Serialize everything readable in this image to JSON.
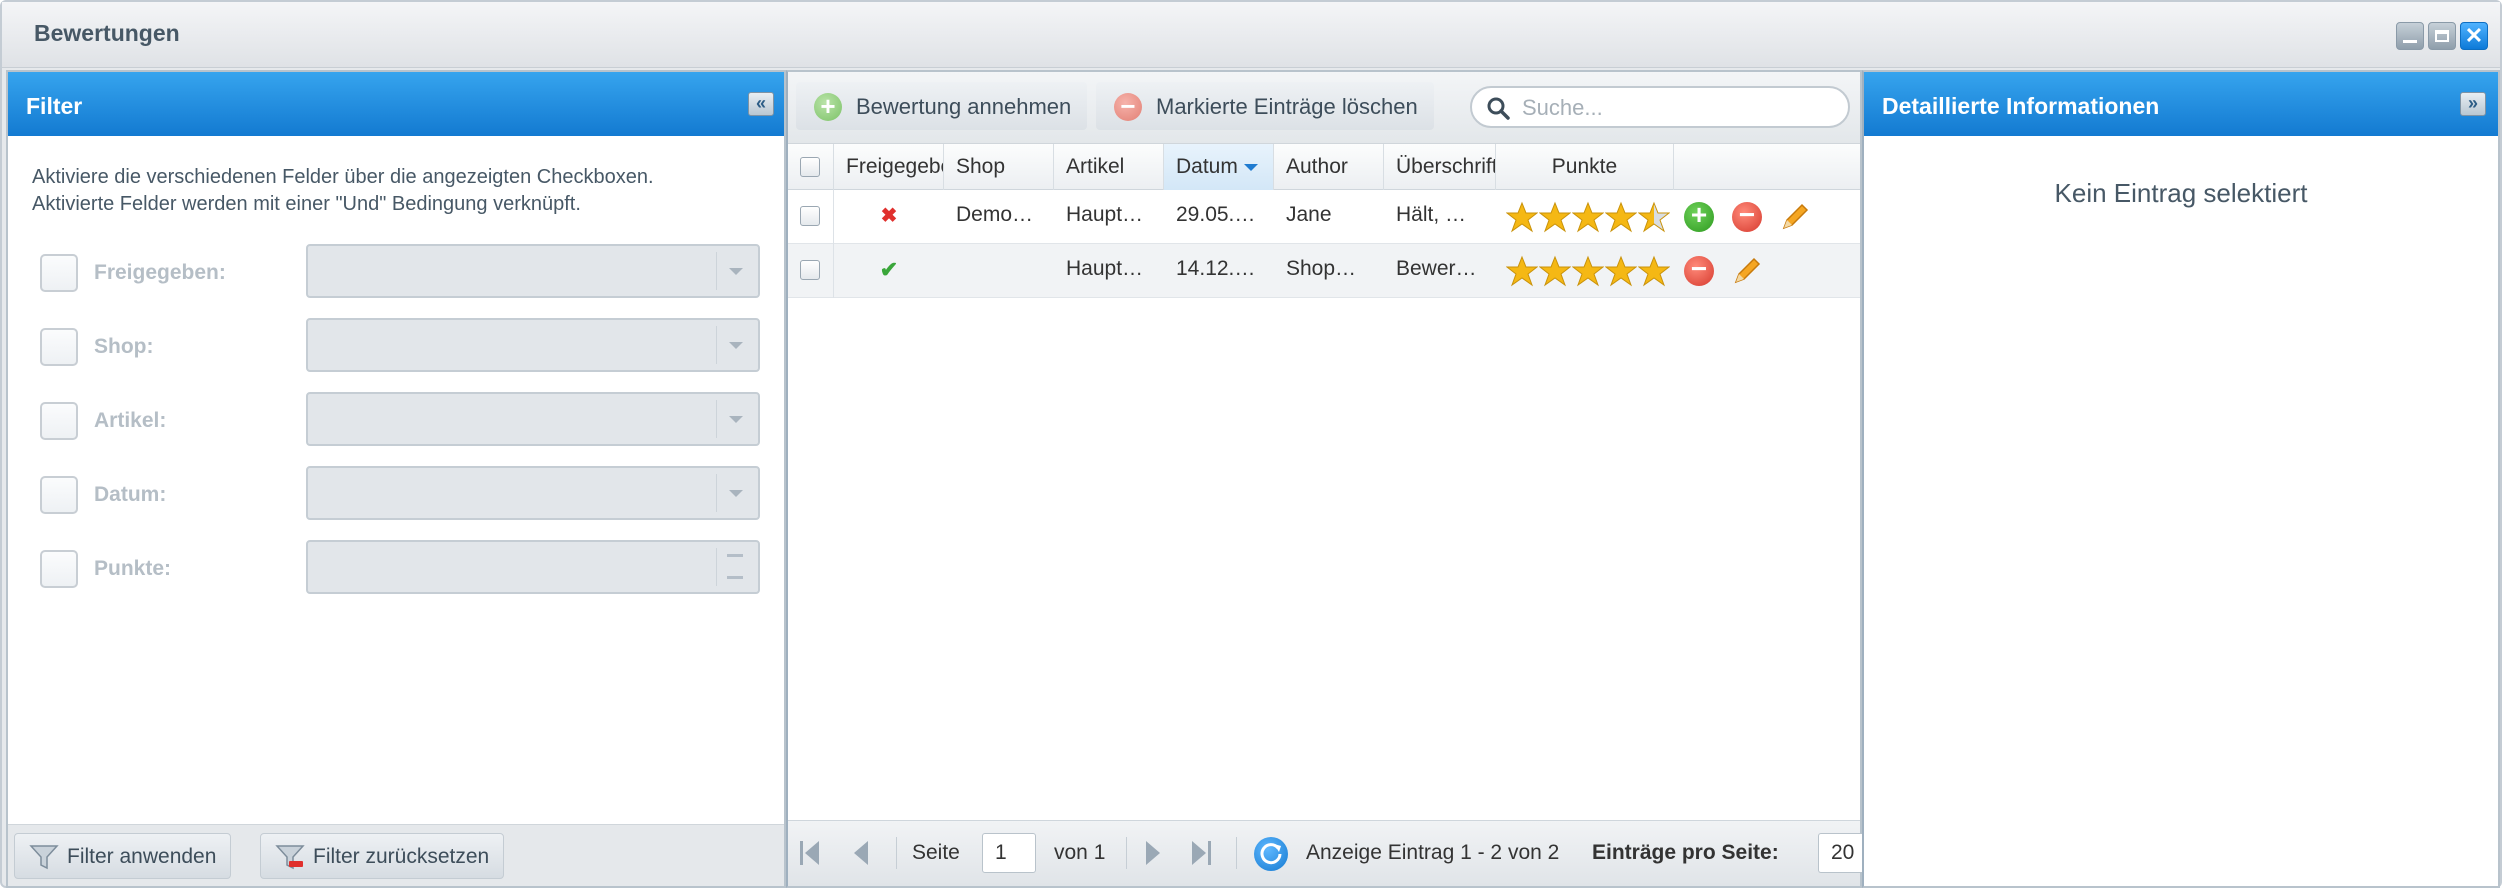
{
  "window": {
    "title": "Bewertungen"
  },
  "filter": {
    "header": "Filter",
    "collapse_glyph": "«",
    "info_line1": "Aktiviere die verschiedenen Felder über die angezeigten Checkboxen.",
    "info_line2": "Aktivierte Felder werden mit einer \"Und\" Bedingung verknüpft.",
    "fields": [
      {
        "label": "Freigegeben:",
        "type": "combo"
      },
      {
        "label": "Shop:",
        "type": "combo"
      },
      {
        "label": "Artikel:",
        "type": "combo"
      },
      {
        "label": "Datum:",
        "type": "combo"
      },
      {
        "label": "Punkte:",
        "type": "number"
      }
    ],
    "apply_label": "Filter anwenden",
    "reset_label": "Filter zurücksetzen"
  },
  "toolbar": {
    "accept_label": "Bewertung annehmen",
    "delete_label": "Markierte Einträge löschen",
    "search_placeholder": "Suche..."
  },
  "grid": {
    "columns": [
      "Freigegeben",
      "Shop",
      "Artikel",
      "Datum",
      "Author",
      "Überschrift",
      "Punkte"
    ],
    "sorted_column": "Datum",
    "rows": [
      {
        "status": "✖",
        "shop": "Demo…",
        "artikel": "Haupt…",
        "datum": "29.05.…",
        "author": "Jane",
        "ueberschrift": "Hält, …",
        "punkte": 4.5,
        "actions": [
          "add",
          "delete",
          "edit"
        ]
      },
      {
        "status": "✔",
        "shop": "",
        "artikel": "Haupt…",
        "datum": "14.12.…",
        "author": "Shop…",
        "ueberschrift": "Bewer…",
        "punkte": 5,
        "actions": [
          "delete",
          "edit"
        ]
      }
    ]
  },
  "pager": {
    "page_label": "Seite",
    "page_value": "1",
    "of_label": "von 1",
    "display_info": "Anzeige Eintrag 1 - 2 von 2",
    "per_page_label": "Einträge pro Seite:",
    "per_page_value": "20"
  },
  "detail": {
    "header": "Detaillierte Informationen",
    "expand_glyph": "»",
    "empty_text": "Kein Eintrag selektiert"
  },
  "colors": {
    "header_blue": "#1f8de0",
    "star_gold": "#f5b814",
    "add_green": "#3aa63a",
    "delete_red": "#e0302d"
  }
}
